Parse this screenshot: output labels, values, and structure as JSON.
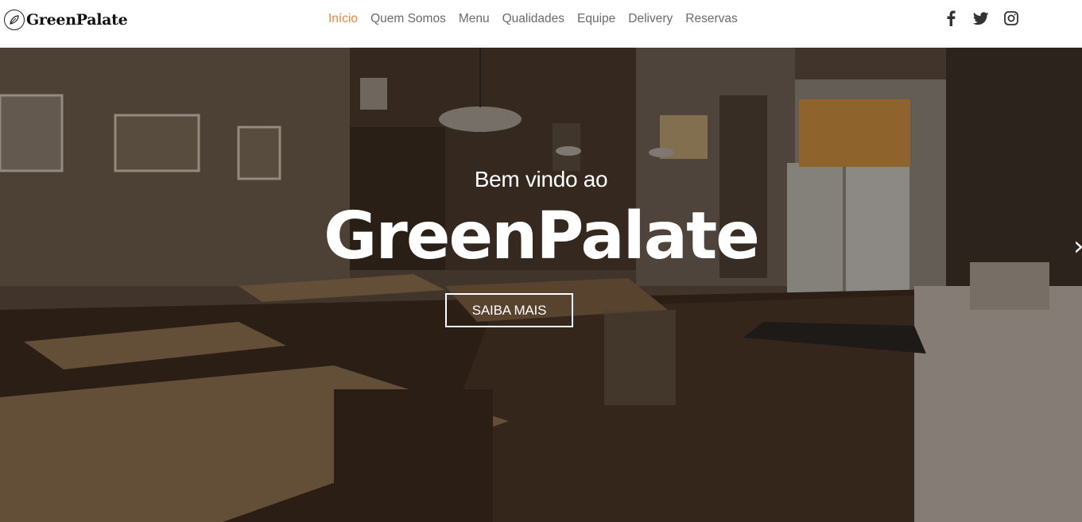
{
  "brand": {
    "name": "GreenPalate",
    "icon": "leaf-icon"
  },
  "nav": {
    "items": [
      {
        "label": "Início",
        "active": true
      },
      {
        "label": "Quem Somos",
        "active": false
      },
      {
        "label": "Menu",
        "active": false
      },
      {
        "label": "Qualidades",
        "active": false
      },
      {
        "label": "Equipe",
        "active": false
      },
      {
        "label": "Delivery",
        "active": false
      },
      {
        "label": "Reservas",
        "active": false
      }
    ]
  },
  "social": [
    "facebook-icon",
    "twitter-icon",
    "instagram-icon"
  ],
  "hero": {
    "subtitle": "Bem vindo ao",
    "title": "GreenPalate",
    "button": "SAIBA MAIS"
  },
  "colors": {
    "accent": "#e8833a",
    "nav_text": "#6b6b6b"
  }
}
